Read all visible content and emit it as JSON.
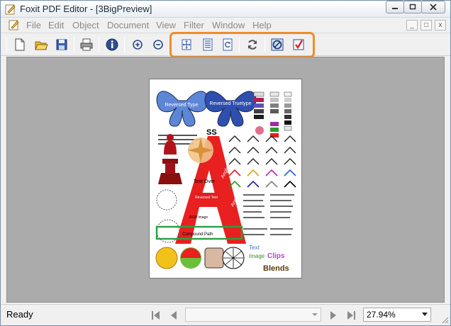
{
  "window": {
    "title": "Foxit PDF Editor - [3BigPreview]",
    "controls": [
      "minimize-icon",
      "maximize-icon",
      "close-icon"
    ]
  },
  "menu": {
    "items": [
      "File",
      "Edit",
      "Object",
      "Document",
      "View",
      "Filter",
      "Window",
      "Help"
    ],
    "mdi_controls": [
      "_",
      "□",
      "x"
    ]
  },
  "toolbar": {
    "buttons": [
      "new-document-icon",
      "open-folder-icon",
      "save-icon",
      "print-icon",
      "document-properties-icon",
      "zoom-in-icon",
      "zoom-out-icon",
      "fit-page-icon",
      "page-view-icon",
      "rotate-icon",
      "refresh-icon",
      "clip-icon",
      "check-icon"
    ],
    "highlight_color": "#f08c2a"
  },
  "document": {
    "title": "3BigPreview",
    "preview_labels": {
      "reversed_type": "Reversed Type",
      "reversed_truetype": "Reversed Truetype",
      "ss": "SS",
      "text_over": "Text Over",
      "reversed_text": "Reversed Text",
      "rgb_image": "RGB Image",
      "compound_path": "Compound Path",
      "text": "Text",
      "image": "Image",
      "clips": "Clips",
      "blends": "Blends",
      "angled_type": "Angled Type",
      "angled_truetype": "Angled Truetype"
    }
  },
  "status": {
    "text": "Ready",
    "page_field_value": "",
    "zoom": "27.94%"
  },
  "colors": {
    "workarea": "#ababab",
    "accent_orange": "#f08c2a",
    "titlebar_text": "#1b2a3a"
  }
}
